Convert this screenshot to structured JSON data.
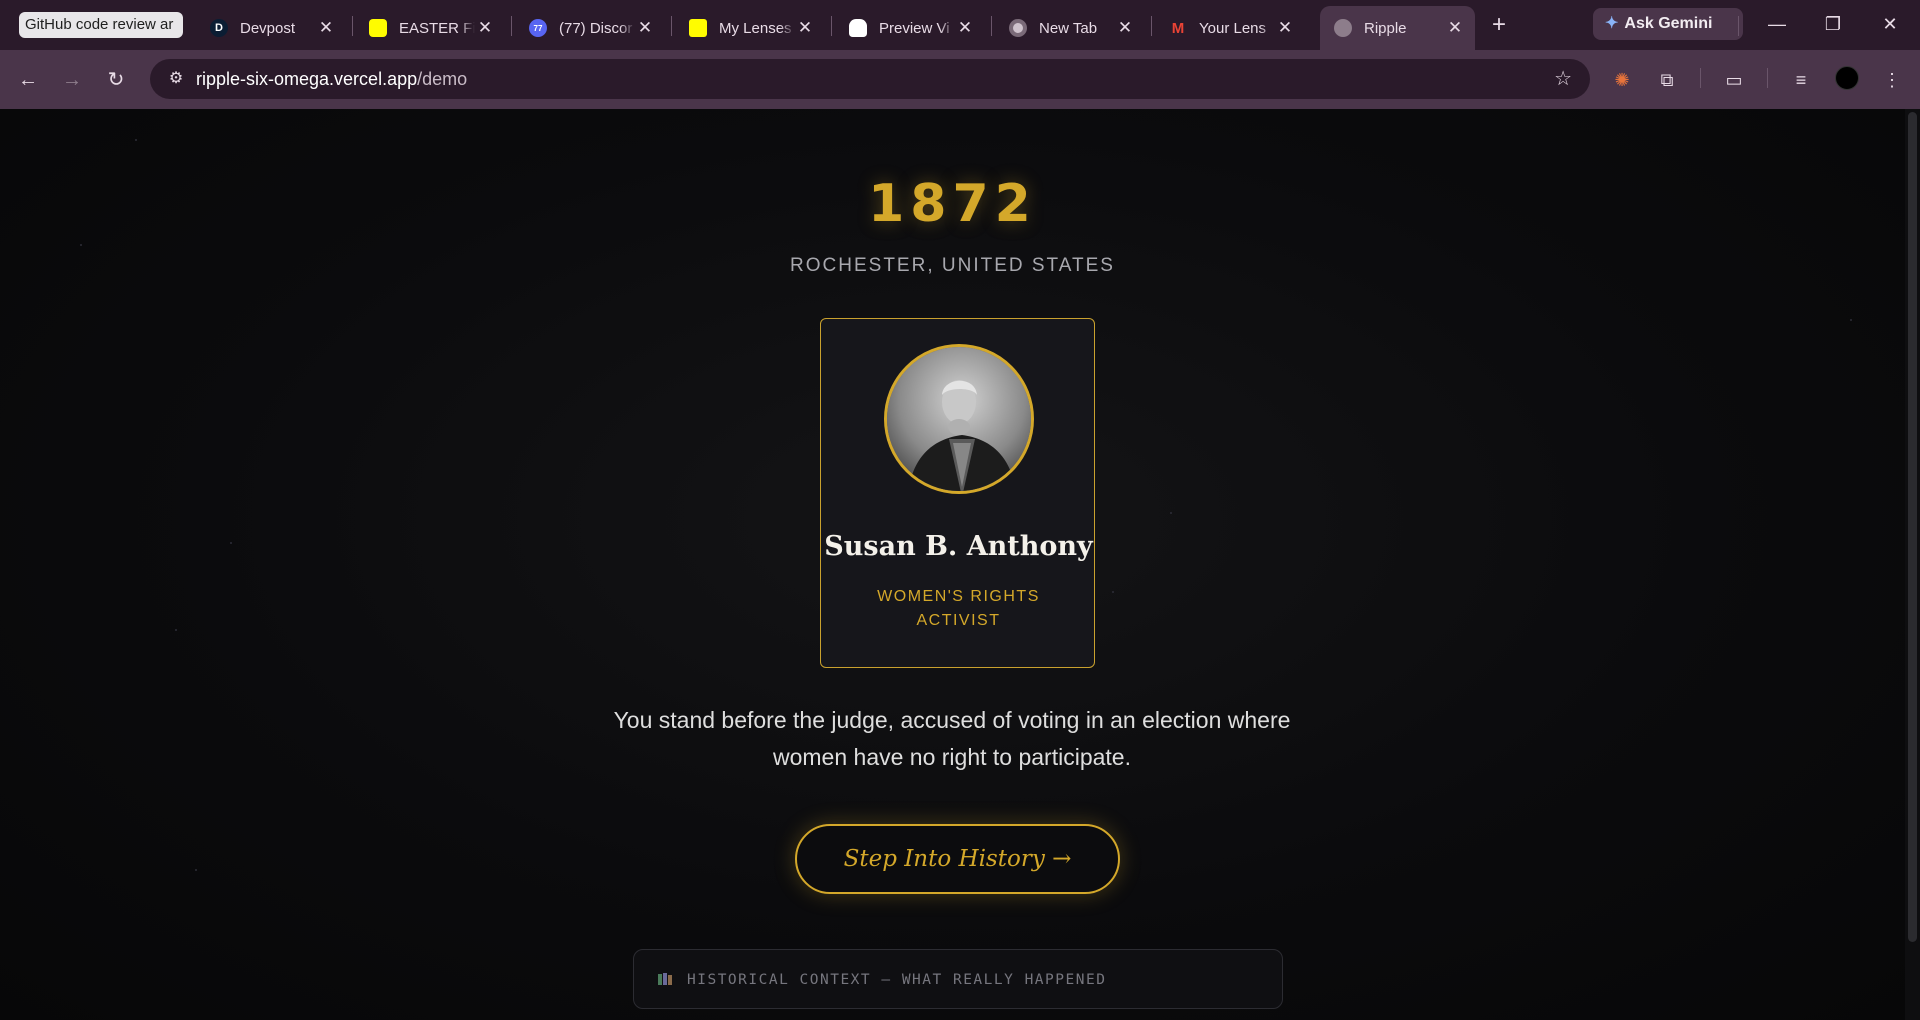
{
  "browser": {
    "tab_group_label": "GitHub code review ar",
    "tabs": [
      {
        "title": "Devpost",
        "icon": "devpost-icon",
        "icon_text": "D"
      },
      {
        "title": "EASTER Filt",
        "icon": "snapchat-icon",
        "icon_text": ""
      },
      {
        "title": "(77) Discor",
        "icon": "discord-icon",
        "icon_text": "77"
      },
      {
        "title": "My Lenses",
        "icon": "lens-icon",
        "icon_text": ""
      },
      {
        "title": "Preview Vi",
        "icon": "snapchat-ghost-icon",
        "icon_text": ""
      },
      {
        "title": "New Tab",
        "icon": "chrome-icon",
        "icon_text": ""
      },
      {
        "title": "Your Lens",
        "icon": "gmail-icon",
        "icon_text": "M"
      },
      {
        "title": "Ripple",
        "icon": "globe-icon",
        "icon_text": "",
        "active": true
      }
    ],
    "ask_gemini_label": "Ask Gemini",
    "url_host": "ripple-six-omega.vercel.app",
    "url_path": "/demo"
  },
  "scene": {
    "year": "1872",
    "location": "ROCHESTER, UNITED STATES",
    "figure_name": "Susan B. Anthony",
    "figure_role": "WOMEN'S RIGHTS ACTIVIST",
    "scenario_text": "You stand before the judge, accused of voting in an election where women have no right to participate.",
    "cta_label": "Step Into History →",
    "context_label": "HISTORICAL CONTEXT — WHAT REALLY HAPPENED"
  },
  "colors": {
    "accent_gold": "#d4a82a",
    "page_background": "#0a0a0c",
    "browser_frame": "#4a354a"
  }
}
